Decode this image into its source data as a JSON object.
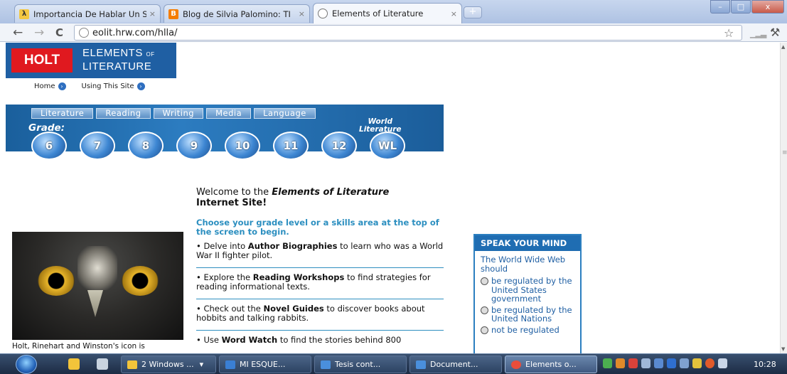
{
  "browser": {
    "tabs": [
      {
        "title": "Importancia De Hablar Un S",
        "active": false,
        "favicon_color": "#f4c842"
      },
      {
        "title": "Blog de Silvia Palomino: TI",
        "active": false,
        "favicon_color": "#f57d00"
      },
      {
        "title": "Elements of Literature",
        "active": true,
        "favicon_color": "#777777"
      }
    ],
    "new_tab_label": "+",
    "window_controls": {
      "minimize": "–",
      "maximize": "□",
      "close": "x"
    },
    "back": "←",
    "forward": "→",
    "reload": "C",
    "url": "eolit.hrw.com/hlla/",
    "star": "☆",
    "wrench": "🔧"
  },
  "page": {
    "logo": {
      "brand": "HOLT",
      "title_line1": "ELEMENTS",
      "title_of": "OF",
      "title_line2": "LITERATURE",
      "colors": {
        "bg": "#1f5fa3",
        "brand_bg": "#e0191f"
      }
    },
    "top_links": [
      {
        "label": "Home",
        "icon": "info-icon"
      },
      {
        "label": "Using This Site",
        "icon": "info-icon"
      }
    ],
    "categories": [
      "Literature",
      "Reading",
      "Writing",
      "Media",
      "Language"
    ],
    "grade_label": "Grade:",
    "world_lit_label_1": "World",
    "world_lit_label_2": "Literature",
    "grades": [
      "6",
      "7",
      "8",
      "9",
      "10",
      "11",
      "12",
      "WL"
    ],
    "welcome_pre": "Welcome to the ",
    "welcome_em": "Elements of Literature",
    "welcome_post": "Internet Site!",
    "choose": "Choose your grade level or a skills area at the top of the screen to begin.",
    "bullets": [
      {
        "pre": "• Delve into ",
        "bold": "Author Biographies",
        "post": " to learn who was a World War II fighter pilot."
      },
      {
        "pre": "• Explore the ",
        "bold": "Reading Workshops",
        "post": " to find strategies for reading informational texts."
      },
      {
        "pre": "• Check out the ",
        "bold": "Novel Guides",
        "post": " to discover books about hobbits and talking rabbits."
      },
      {
        "pre": "• Use ",
        "bold": "Word Watch",
        "post": " to find the stories behind 800"
      }
    ],
    "owl_caption": "Holt, Rinehart and Winston's icon is",
    "poll": {
      "header": "SPEAK YOUR MIND",
      "question": "The World Wide Web should",
      "options": [
        "be regulated by the United States government",
        "be regulated by the United Nations",
        "not be regulated"
      ]
    }
  },
  "taskbar": {
    "buttons": [
      {
        "label": "2 Windows ...",
        "arrow": "▾",
        "icon_color": "#f2c43a",
        "active": false
      },
      {
        "label": "MI ESQUE...",
        "icon_color": "#3a7fd4",
        "active": false
      },
      {
        "label": "Tesis cont...",
        "icon_color": "#4a8fdc",
        "active": false
      },
      {
        "label": "Document...",
        "icon_color": "#4a8fdc",
        "active": false
      },
      {
        "label": "Elements o...",
        "icon_color": "#e94d3b",
        "active": true
      }
    ],
    "clock": "10:28"
  }
}
